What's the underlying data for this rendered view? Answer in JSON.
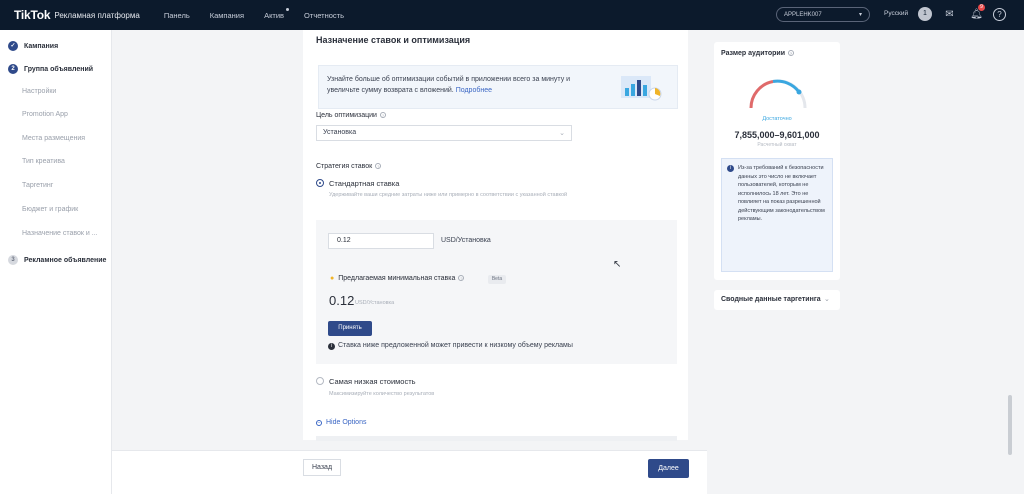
{
  "header": {
    "logo": "TikTok",
    "logo_sub": "Рекламная платформа",
    "nav": [
      "Панель",
      "Кампания",
      "Актив",
      "Отчетность"
    ],
    "account": "APPLEHK007",
    "language": "Русский",
    "avatar": "1",
    "notif_count": "9"
  },
  "sidebar": {
    "steps": [
      {
        "label": "Кампания",
        "state": "done"
      },
      {
        "label": "Группа объявлений",
        "state": "active",
        "num": "2"
      },
      {
        "label": "Рекламное объявление",
        "state": "pending",
        "num": "3"
      }
    ],
    "sub_items": [
      "Настройки",
      "Promotion App",
      "Места размещения",
      "Тип креатива",
      "Таргетинг",
      "Бюджет и график",
      "Назначение ставок и ..."
    ]
  },
  "main": {
    "title": "Назначение ставок и оптимизация",
    "info": {
      "text": "Узнайте больше об оптимизации событий в приложении всего за минуту и увеличьте сумму возврата с вложений.",
      "link": "Подробнее"
    },
    "goal_label": "Цель оптимизации",
    "goal_value": "Установка",
    "strategy_label": "Стратегия ставок",
    "standard_label": "Стандартная ставка",
    "standard_desc": "Удерживайте ваши средние затраты ниже или примерно в соответствии с указанной ставкой",
    "bid_value": "0.12",
    "bid_unit": "USD/Установка",
    "suggested_label": "Предлагаемая минимальная ставка",
    "beta": "Beta",
    "suggested_value": "0.12",
    "suggested_unit": "USD/Установка",
    "apply": "Принять",
    "warning": "Ставка ниже предложенной может привести к низкому объему рекламы",
    "lowest_label": "Самая низкая стоимость",
    "lowest_desc": "Максимизируйте количество результатов",
    "hide_options": "Hide Options"
  },
  "footer": {
    "back": "Назад",
    "next": "Далее"
  },
  "audience": {
    "title": "Размер аудитории",
    "gauge_label": "Достаточно",
    "range": "7,855,000–9,601,000",
    "sub": "Расчетный охват",
    "note": "Из-за требований к безопасности данных это число не включает пользователей, которым не исполнилось 18 лет. Это не повлияет на показ разрешенной действующим законодательством рекламы."
  },
  "summary": {
    "title": "Сводные данные таргетинга"
  },
  "colors": {
    "primary": "#2f4a8a",
    "topbar": "#0c1a2c",
    "link": "#3a66c4"
  }
}
